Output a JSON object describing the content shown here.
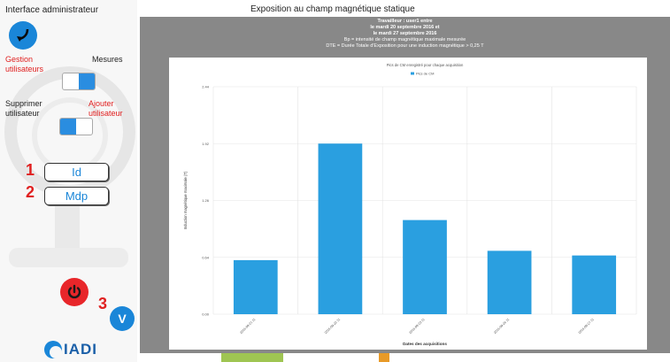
{
  "admin": {
    "title": "Interface administrateur",
    "gestion_line1": "Gestion",
    "gestion_line2": "utilisateurs",
    "mesures": "Mesures",
    "supprimer_line1": "Supprimer",
    "supprimer_line2": "utilisateur",
    "ajouter_line1": "Ajouter",
    "ajouter_line2": "utilisateur",
    "num1": "1",
    "num2": "2",
    "num3": "3",
    "id_label": "Id",
    "mdp_label": "Mdp",
    "validate_label": "V",
    "logo_text": "IADI"
  },
  "panel": {
    "title": "Exposition au champ magnétique statique",
    "line1": "Travailleur : user1 entre",
    "line2": "le mardi 20 septembre 2016 et",
    "line3": "le mardi 27 septembre 2016",
    "line4": "Bp = intensité de champ magnétique maximale mesurée",
    "line5": "DTE = Durée Totale d'Exposition pour une induction magnétique > 0,25 T"
  },
  "colors": {
    "accent": "#1a86d8",
    "danger": "#e8262a",
    "bar": "#2a9fe0",
    "panel_gray": "#888888"
  },
  "chart_data": {
    "type": "bar",
    "title": "Pics de CM enregistré pour chaque acquisition",
    "legend": "Pics de CM",
    "xlabel": "Dates des acquisitions",
    "ylabel": "Induction magnétique maximale (T)",
    "categories": [
      "2016-09-21 11",
      "2016-09-22 11",
      "2016-09-23 11",
      "2016-09-26 11",
      "2016-09-27 11"
    ],
    "values": [
      0.58,
      1.83,
      1.01,
      0.68,
      0.63
    ],
    "yticks": [
      "0.00",
      "0.64",
      "1.26",
      "1.92",
      "2.44"
    ],
    "ylim": [
      0,
      2.44
    ],
    "grid": true,
    "legend_position": "top-center"
  }
}
